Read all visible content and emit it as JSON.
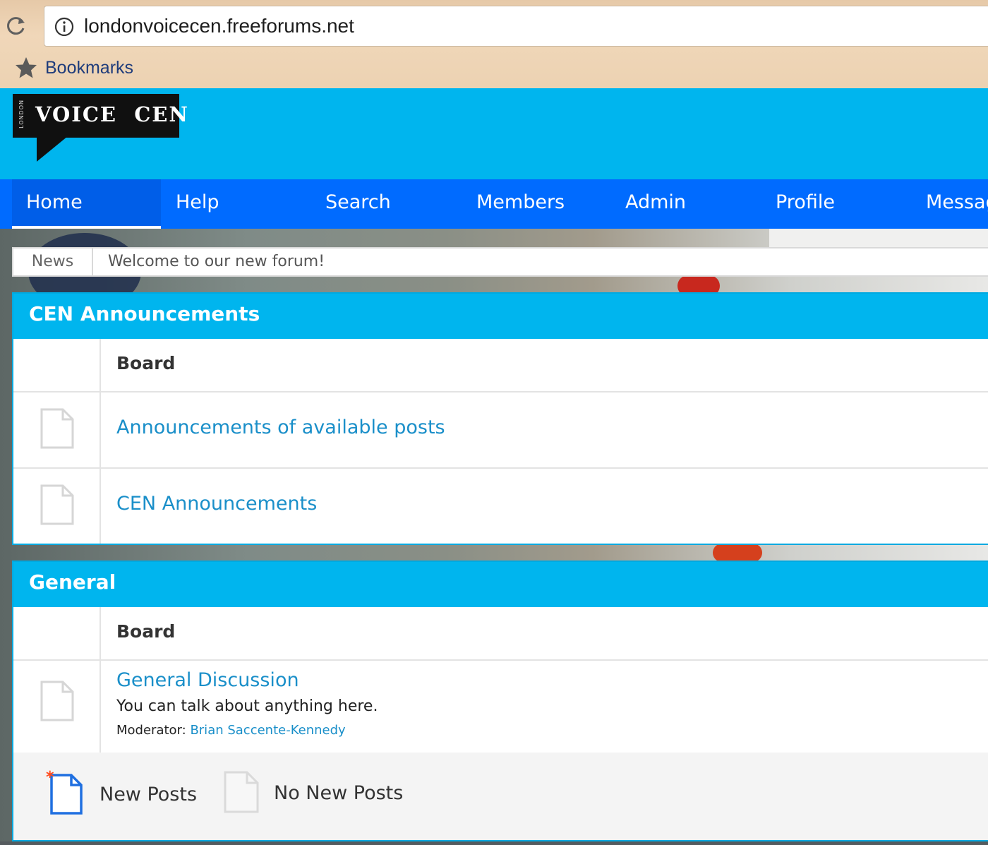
{
  "browser": {
    "url": "londonvoicecen.freeforums.net",
    "bookmarks_label": "Bookmarks"
  },
  "header": {
    "logo_text": "VOICE  CEN",
    "logo_side_text": "LONDON"
  },
  "nav": {
    "items": [
      {
        "label": "Home",
        "active": true
      },
      {
        "label": "Help"
      },
      {
        "label": "Search"
      },
      {
        "label": "Members"
      },
      {
        "label": "Admin"
      },
      {
        "label": "Profile"
      },
      {
        "label": "Messag"
      }
    ]
  },
  "news": {
    "label": "News",
    "text": "Welcome to our new forum!"
  },
  "categories": [
    {
      "title": "CEN Announcements",
      "board_header": "Board",
      "boards": [
        {
          "name": "Announcements of available posts"
        },
        {
          "name": "CEN Announcements"
        }
      ]
    },
    {
      "title": "General",
      "board_header": "Board",
      "boards": [
        {
          "name": "General Discussion",
          "description": "You can talk about anything here.",
          "moderator_label": "Moderator:",
          "moderator_name": "Brian Saccente-Kennedy"
        }
      ]
    }
  ],
  "legend": {
    "new_posts": "New Posts",
    "no_new_posts": "No New Posts"
  },
  "colors": {
    "header_bg": "#00b5ee",
    "nav_bg": "#006bff",
    "link": "#1a8fc9",
    "new_post_accent": "#ff4a1c"
  }
}
